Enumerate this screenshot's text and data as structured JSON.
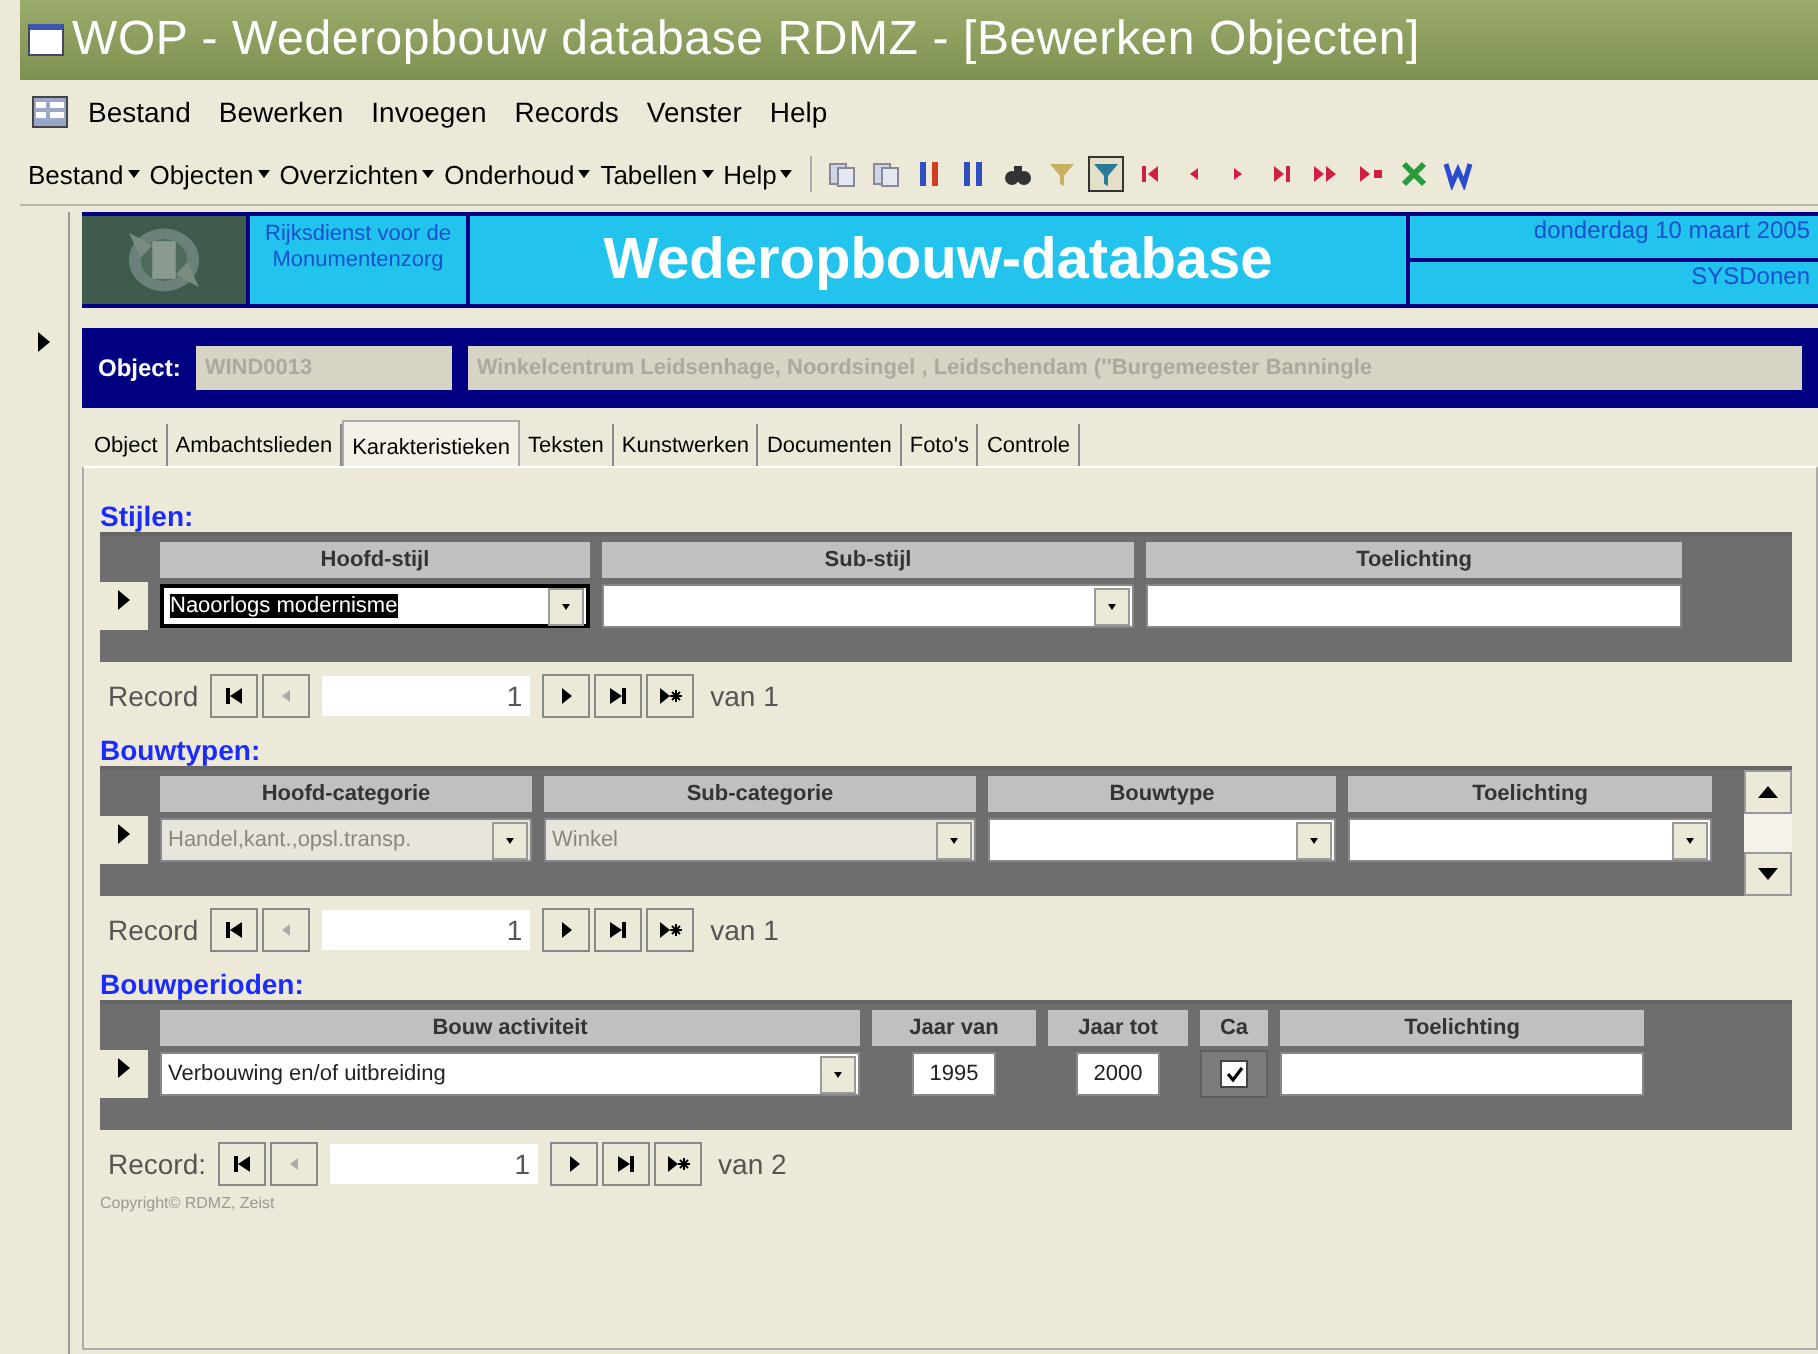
{
  "window": {
    "title": "WOP - Wederopbouw database RDMZ - [Bewerken Objecten]"
  },
  "menu": [
    "Bestand",
    "Bewerken",
    "Invoegen",
    "Records",
    "Venster",
    "Help"
  ],
  "toolbar_menus": [
    "Bestand",
    "Objecten",
    "Overzichten",
    "Onderhoud",
    "Tabellen",
    "Help"
  ],
  "header": {
    "organisation": "Rijksdienst voor de Monumentenzorg",
    "title": "Wederopbouw-database",
    "date": "donderdag 10 maart 2005",
    "user": "SYSDonen"
  },
  "object": {
    "label": "Object:",
    "code": "WIND0013",
    "description": "Winkelcentrum Leidsenhage, Noordsingel ,  Leidschendam (''Burgemeester Banningle"
  },
  "tabs": [
    {
      "label": "Object",
      "selected": false
    },
    {
      "label": "Ambachtslieden",
      "selected": false
    },
    {
      "label": "Karakteristieken",
      "selected": true
    },
    {
      "label": "Teksten",
      "selected": false
    },
    {
      "label": "Kunstwerken",
      "selected": false
    },
    {
      "label": "Documenten",
      "selected": false
    },
    {
      "label": "Foto's",
      "selected": false
    },
    {
      "label": "Controle",
      "selected": false
    }
  ],
  "subforms": [
    {
      "title": "Stijlen:",
      "scrollbar": false,
      "columns": [
        "Hoofd-stijl",
        "Sub-stijl",
        "Toelichting"
      ],
      "cells": [
        {
          "kind": "combo",
          "value": "Naoorlogs modernisme",
          "highlighted": true,
          "disabled": false
        },
        {
          "kind": "combo",
          "highlighted": false,
          "disabled": false
        },
        {
          "kind": "text",
          "highlighted": false,
          "disabled": false
        }
      ],
      "navigator": {
        "label": "Record",
        "current": "1",
        "total": "van 1"
      }
    },
    {
      "title": "Bouwtypen:",
      "scrollbar": true,
      "columns": [
        "Hoofd-categorie",
        "Sub-categorie",
        "Bouwtype",
        "Toelichting"
      ],
      "cells": [
        {
          "kind": "combo",
          "value": "Handel,kant.,opsl.transp.",
          "highlighted": false,
          "disabled": true
        },
        {
          "kind": "combo",
          "value": "Winkel",
          "highlighted": false,
          "disabled": true
        },
        {
          "kind": "combo",
          "highlighted": false,
          "disabled": false
        },
        {
          "kind": "combo",
          "highlighted": false,
          "disabled": false
        }
      ],
      "navigator": {
        "label": "Record",
        "current": "1",
        "total": "van 1"
      }
    },
    {
      "title": "Bouwperioden:",
      "scrollbar": false,
      "columns": [
        "Bouw activiteit",
        "Jaar van",
        "Jaar tot",
        "Ca",
        "Toelichting"
      ],
      "cells": [
        {
          "kind": "combo",
          "value": "Verbouwing en/of uitbreiding",
          "highlighted": false,
          "disabled": false
        },
        {
          "kind": "year",
          "value": "1995",
          "highlighted": false,
          "disabled": false
        },
        {
          "kind": "year",
          "value": "2000",
          "highlighted": false,
          "disabled": false
        },
        {
          "kind": "checkbox",
          "checked": true,
          "highlighted": false,
          "disabled": false
        },
        {
          "kind": "text",
          "highlighted": false,
          "disabled": false
        }
      ],
      "navigator": {
        "label": "Record:",
        "current": "1",
        "total": "van 2"
      }
    }
  ],
  "copyright": "Copyright© RDMZ, Zeist"
}
